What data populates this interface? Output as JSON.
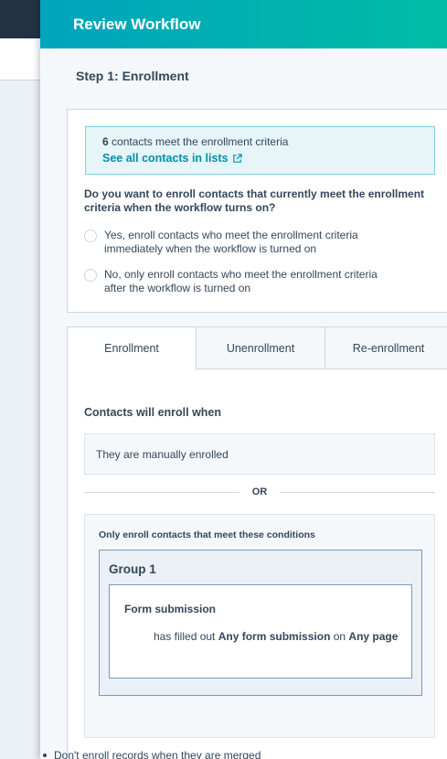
{
  "panel": {
    "title": "Review Workflow",
    "step_title": "Step 1: Enrollment"
  },
  "enrollment_info": {
    "count": "6",
    "count_text": " contacts meet the enrollment criteria",
    "link_label": "See all contacts in lists"
  },
  "enroll_question": {
    "question": "Do you want to enroll contacts that currently meet the enrollment criteria when the workflow turns on?",
    "options": [
      {
        "label": "Yes, enroll contacts who meet the enrollment criteria immediately when the workflow is turned on",
        "selected": false
      },
      {
        "label": "No, only enroll contacts who meet the enrollment criteria after the workflow is turned on",
        "selected": false
      }
    ]
  },
  "tabs": [
    {
      "label": "Enrollment",
      "active": true
    },
    {
      "label": "Unenrollment",
      "active": false
    },
    {
      "label": "Re-enrollment",
      "active": false
    }
  ],
  "enrollment_tab": {
    "heading": "Contacts will enroll when",
    "trigger": "They are manually enrolled",
    "or_label": "OR",
    "conditions_title": "Only enroll contacts that meet these conditions",
    "group_title": "Group 1",
    "filter_title": "Form submission",
    "filter_desc_prefix": "has filled out ",
    "filter_desc_value1": "Any form submission",
    "filter_desc_mid": " on ",
    "filter_desc_value2": "Any page"
  },
  "footer_note": "Don't enroll records when they are merged",
  "colors": {
    "header_gradient_start": "#00a4bd",
    "header_gradient_end": "#00bda5",
    "link": "#0091ae",
    "text": "#33475b"
  }
}
